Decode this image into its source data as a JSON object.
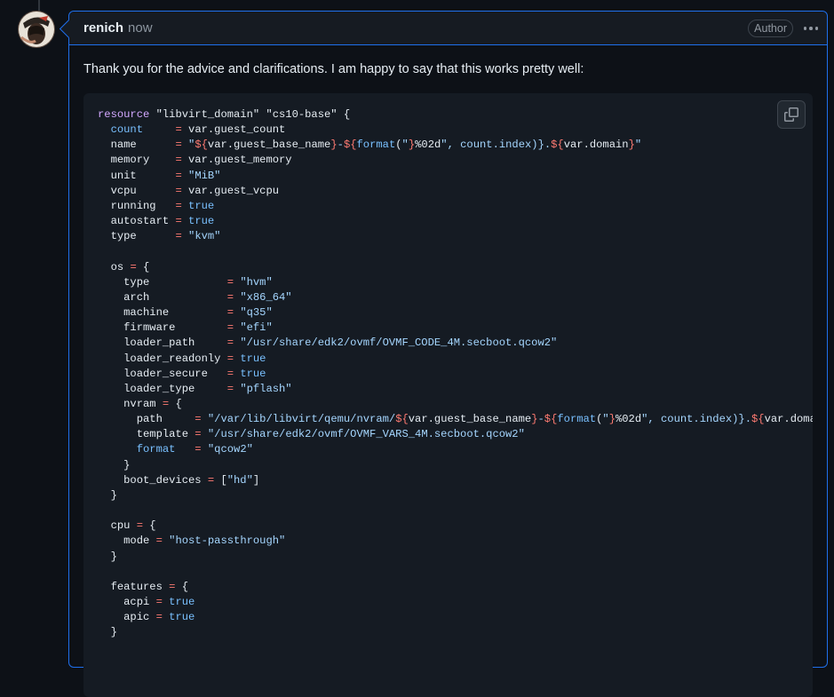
{
  "comment": {
    "author": "renich",
    "timestamp": "now",
    "badge": "Author",
    "text": "Thank you for the advice and clarifications. I am happy to say that this works pretty well:"
  },
  "icons": {
    "avatar": "avatar",
    "kebab": "kebab-horizontal-icon",
    "copy": "copy-icon"
  },
  "code": {
    "language": "hcl",
    "lines": [
      "resource \"libvirt_domain\" \"cs10-base\" {",
      "  count     = var.guest_count",
      "  name      = \"${var.guest_base_name}-${format(\"%02d\", count.index)}.${var.domain}\"",
      "  memory    = var.guest_memory",
      "  unit      = \"MiB\"",
      "  vcpu      = var.guest_vcpu",
      "  running   = true",
      "  autostart = true",
      "  type      = \"kvm\"",
      "",
      "  os = {",
      "    type            = \"hvm\"",
      "    arch            = \"x86_64\"",
      "    machine         = \"q35\"",
      "    firmware        = \"efi\"",
      "    loader_path     = \"/usr/share/edk2/ovmf/OVMF_CODE_4M.secboot.qcow2\"",
      "    loader_readonly = true",
      "    loader_secure   = true",
      "    loader_type     = \"pflash\"",
      "    nvram = {",
      "      path     = \"/var/lib/libvirt/qemu/nvram/${var.guest_base_name}-${format(\"%02d\", count.index)}.${var.domain}",
      "      template = \"/usr/share/edk2/ovmf/OVMF_VARS_4M.secboot.qcow2\"",
      "      format   = \"qcow2\"",
      "    }",
      "    boot_devices = [\"hd\"]",
      "  }",
      "",
      "  cpu = {",
      "    mode = \"host-passthrough\"",
      "  }",
      "",
      "  features = {",
      "    acpi = true",
      "    apic = true",
      "  }"
    ]
  },
  "colors": {
    "background": "#0d1117",
    "header_bg": "#161b22",
    "border_accent": "#1f6feb",
    "code_bg": "#151b23",
    "keyword": "#d2a8ff",
    "string": "#a5d6ff",
    "operator": "#ff7b72",
    "constant": "#79c0ff",
    "text": "#e6edf3",
    "muted": "#8d96a0"
  }
}
